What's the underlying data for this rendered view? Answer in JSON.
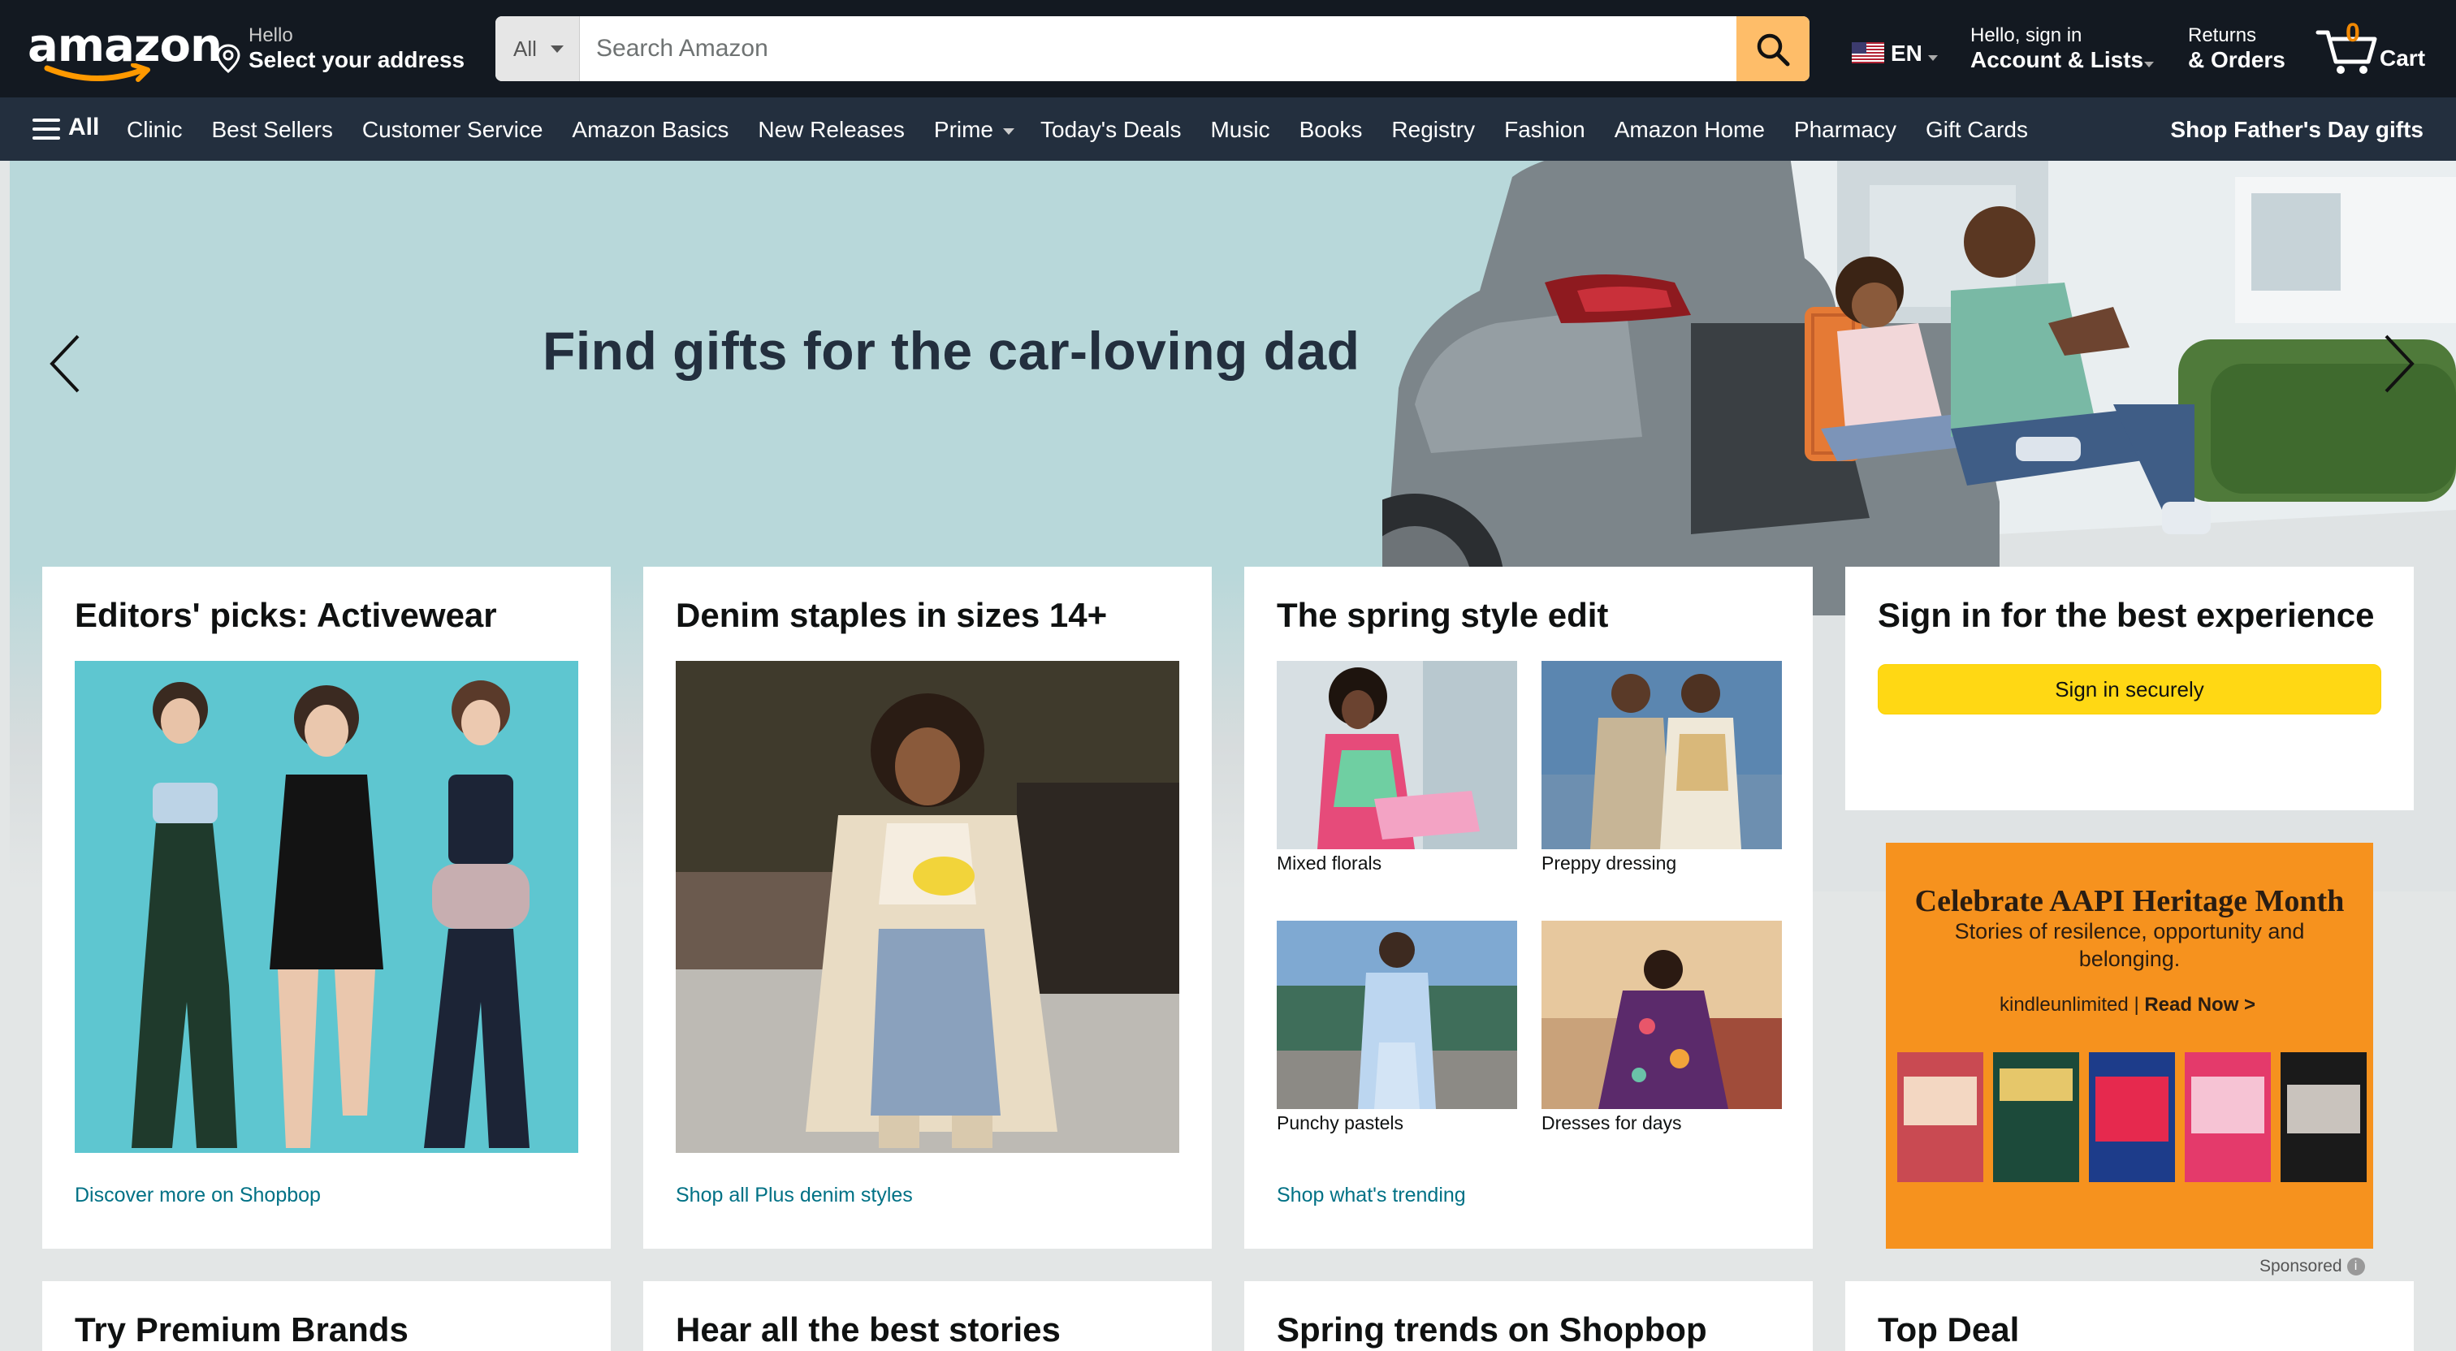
{
  "header": {
    "logo_text": "amazon",
    "location": {
      "line1": "Hello",
      "line2": "Select your address"
    },
    "search": {
      "category": "All",
      "placeholder": "Search Amazon"
    },
    "language": "EN",
    "account": {
      "line1": "Hello, sign in",
      "line2": "Account & Lists"
    },
    "orders": {
      "line1": "Returns",
      "line2": "& Orders"
    },
    "cart": {
      "count": "0",
      "label": "Cart"
    }
  },
  "subnav": {
    "all_label": "All",
    "items": [
      "Clinic",
      "Best Sellers",
      "Customer Service",
      "Amazon Basics",
      "New Releases",
      "Prime",
      "Today's Deals",
      "Music",
      "Books",
      "Registry",
      "Fashion",
      "Amazon Home",
      "Pharmacy",
      "Gift Cards"
    ],
    "promo": "Shop Father's Day gifts"
  },
  "hero": {
    "headline": "Find gifts for the car-loving dad"
  },
  "cards": {
    "activewear": {
      "title": "Editors' picks: Activewear",
      "link": "Discover more on Shopbop"
    },
    "denim": {
      "title": "Denim staples in sizes 14+",
      "link": "Shop all Plus denim styles"
    },
    "spring": {
      "title": "The spring style edit",
      "tiles": [
        "Mixed florals",
        "Preppy dressing",
        "Punchy pastels",
        "Dresses for days"
      ],
      "link": "Shop what's trending"
    },
    "signin": {
      "title": "Sign in for the best experience",
      "button": "Sign in securely"
    }
  },
  "ad": {
    "title": "Celebrate AAPI Heritage Month",
    "subtitle": "Stories of resilence, opportunity and belonging.",
    "brand": "kindleunlimited",
    "cta": "Read Now >",
    "sponsored": "Sponsored"
  },
  "bottom_cards": [
    "Try Premium Brands",
    "Hear all the best stories",
    "Spring trends on Shopbop",
    "Top Deal"
  ],
  "colors": {
    "nav_dark": "#131921",
    "nav_sub": "#232f3e",
    "search_button": "#febd69",
    "signin_button": "#ffd814",
    "link": "#007185",
    "cart_count": "#f08804",
    "ad_orange": "#f6921e"
  }
}
